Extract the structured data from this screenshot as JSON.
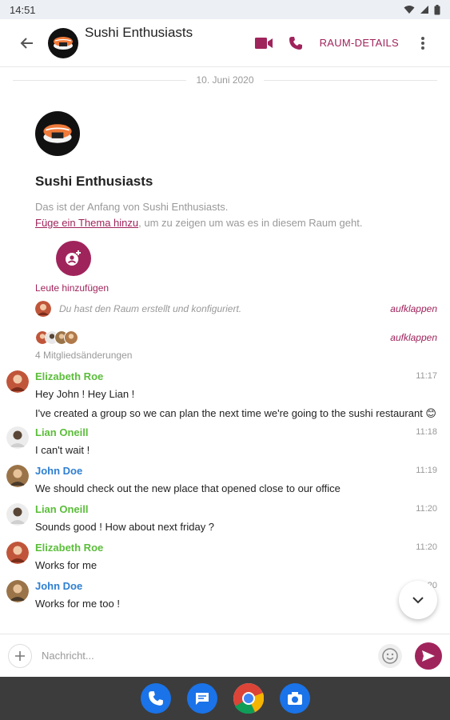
{
  "status": {
    "time": "14:51"
  },
  "appbar": {
    "room_title": "Sushi Enthusiasts",
    "details_label": "RAUM-DETAILS"
  },
  "colors": {
    "accent": "#a0245c",
    "sender_green": "#5bbd3a",
    "sender_blue": "#2f7fd1"
  },
  "timeline": {
    "date_separator": "10. Juni 2020",
    "intro": {
      "name": "Sushi Enthusiasts",
      "start_text": "Das ist der Anfang von Sushi Enthusiasts.",
      "topic_link": "Füge ein Thema hinzu",
      "topic_rest": ", um zu zeigen um was es in diesem Raum geht.",
      "add_people_label": "Leute hinzufügen"
    },
    "notice": {
      "text": "Du hast den Raum erstellt und konfiguriert.",
      "expand": "aufklappen"
    },
    "members": {
      "expand": "aufklappen",
      "count_text": "4 Mitgliedsänderungen"
    },
    "messages": [
      {
        "sender": "Elizabeth Roe",
        "time": "11:17",
        "body": "Hey John ! Hey Lian !"
      },
      {
        "body": "I've created a group so we can plan the next time we're going to the sushi restaurant 😊"
      },
      {
        "sender": "Lian Oneill",
        "time": "11:18",
        "body": "I can't wait !"
      },
      {
        "sender": "John Doe",
        "time": "11:19",
        "body": "We should check out the new place that opened close to our office"
      },
      {
        "sender": "Lian Oneill",
        "time": "11:20",
        "body": "Sounds good ! How about next friday ?"
      },
      {
        "sender": "Elizabeth Roe",
        "time": "11:20",
        "body": "Works for me"
      },
      {
        "sender": "John Doe",
        "time": "11:20",
        "body": "Works for me too !"
      }
    ]
  },
  "composer": {
    "placeholder": "Nachricht..."
  },
  "icons": {
    "back": "arrow-left-icon",
    "video": "video-camera-icon",
    "call": "phone-icon",
    "more": "more-vert-icon",
    "add_people": "person-add-icon",
    "scroll_down": "chevron-down-icon",
    "attach": "plus-icon",
    "emoji": "smiley-icon",
    "send": "send-icon",
    "dock": [
      "phone-app-icon",
      "messages-app-icon",
      "chrome-app-icon",
      "camera-app-icon"
    ]
  }
}
